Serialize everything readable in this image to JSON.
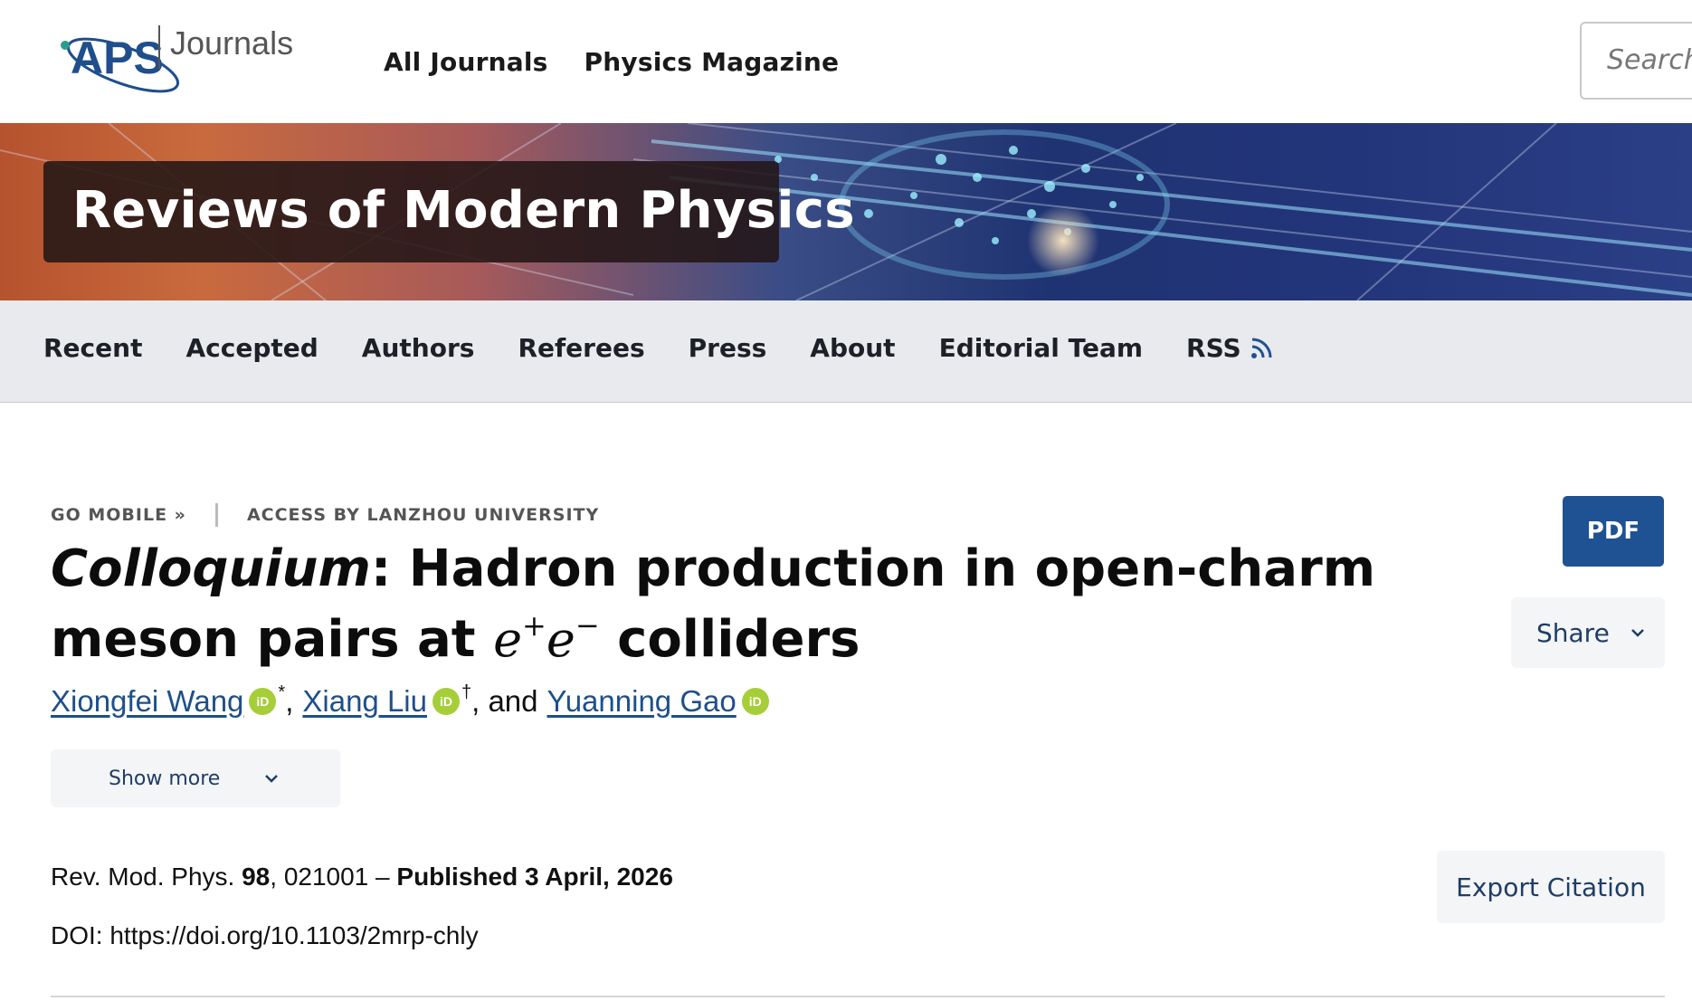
{
  "header": {
    "logo_text": "APS",
    "logo_sub": "Journals",
    "nav": [
      {
        "label": "All Journals"
      },
      {
        "label": "Physics Magazine"
      }
    ],
    "search_placeholder": "Search"
  },
  "banner": {
    "journal_title": "Reviews of Modern Physics"
  },
  "subnav": {
    "items": [
      {
        "label": "Recent"
      },
      {
        "label": "Accepted"
      },
      {
        "label": "Authors"
      },
      {
        "label": "Referees"
      },
      {
        "label": "Press"
      },
      {
        "label": "About"
      },
      {
        "label": "Editorial Team"
      },
      {
        "label": "RSS"
      }
    ]
  },
  "meta": {
    "go_mobile": "GO MOBILE »",
    "access": "ACCESS BY LANZHOU UNIVERSITY"
  },
  "article": {
    "title_italic": "Colloquium",
    "title_rest": ": Hadron production in open-charm meson pairs at",
    "title_e": "e",
    "title_plus": "+",
    "title_e2": "e",
    "title_minus": "−",
    "title_end": "colliders",
    "authors": [
      {
        "name": "Xiongfei Wang",
        "mark": "*"
      },
      {
        "name": "Xiang Liu",
        "mark": "†"
      },
      {
        "name": "Yuanning Gao",
        "mark": ""
      }
    ],
    "orcid_label": "iD",
    "comma": ",",
    "and": ", and",
    "show_more": "Show more",
    "journal_abbrev": "Rev. Mod. Phys.",
    "volume": "98",
    "article_number": ", 021001 –",
    "published": "Published 3 April, 2026",
    "doi": "DOI: https://doi.org/10.1103/2mrp-chly"
  },
  "actions": {
    "pdf": "PDF",
    "share": "Share",
    "export_citation": "Export Citation"
  },
  "colors": {
    "link": "#1e4f8a",
    "button_primary": "#1f5293",
    "orcid": "#a6ce39",
    "logo_blue": "#1f4e8c"
  }
}
